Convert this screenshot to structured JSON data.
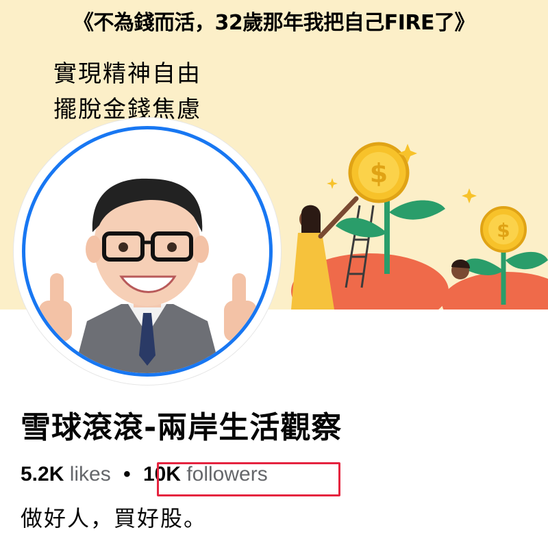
{
  "cover": {
    "title": "《不為錢而活，32歲那年我把自己FIRE了》",
    "line1": "實現精神自由",
    "line2": "擺脫金錢焦慮",
    "colors": {
      "background": "#fcefc8",
      "coin": "#f7c22a",
      "leaf": "#2a9d6a",
      "soil": "#ef6a4a"
    }
  },
  "profile": {
    "ring_color": "#1877f2",
    "name": "雪球滾滾-兩岸生活觀察",
    "likes_count": "5.2K",
    "likes_label": "likes",
    "separator": "•",
    "followers_count": "10K",
    "followers_label": "followers",
    "highlight_color": "#e5233f",
    "bio": "做好人，買好股。"
  }
}
